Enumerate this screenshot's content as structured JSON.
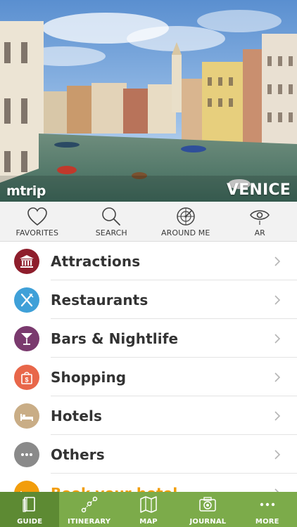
{
  "hero": {
    "brand": "mtrip",
    "city": "VENICE"
  },
  "quick_actions": [
    {
      "label": "FAVORITES",
      "icon": "heart-icon"
    },
    {
      "label": "SEARCH",
      "icon": "search-icon"
    },
    {
      "label": "AROUND ME",
      "icon": "radar-icon"
    },
    {
      "label": "AR",
      "icon": "eye-icon"
    }
  ],
  "categories": [
    {
      "label": "Attractions",
      "icon": "museum-icon",
      "color": "#8e1e2c"
    },
    {
      "label": "Restaurants",
      "icon": "fork-knife-icon",
      "color": "#3fa0d8"
    },
    {
      "label": "Bars & Nightlife",
      "icon": "cocktail-icon",
      "color": "#7a3a6e"
    },
    {
      "label": "Shopping",
      "icon": "shopping-bag-icon",
      "color": "#e8674a"
    },
    {
      "label": "Hotels",
      "icon": "bed-icon",
      "color": "#c9ad86"
    },
    {
      "label": "Others",
      "icon": "more-dots-icon",
      "color": "#8a8a8a"
    },
    {
      "label": "Book your hotel",
      "icon": "bed-icon",
      "color": "#f29d0b"
    }
  ],
  "tabs": [
    {
      "label": "GUIDE",
      "icon": "guide-book-icon",
      "active": true
    },
    {
      "label": "ITINERARY",
      "icon": "itinerary-icon",
      "active": false
    },
    {
      "label": "MAP",
      "icon": "map-icon",
      "active": false
    },
    {
      "label": "JOURNAL",
      "icon": "camera-icon",
      "active": false
    },
    {
      "label": "MORE",
      "icon": "more-dots-icon",
      "active": false
    }
  ],
  "colors": {
    "tabbar": "#7cab4a",
    "tabbar_active": "#5d8a33",
    "accent_book": "#f29d0b"
  }
}
